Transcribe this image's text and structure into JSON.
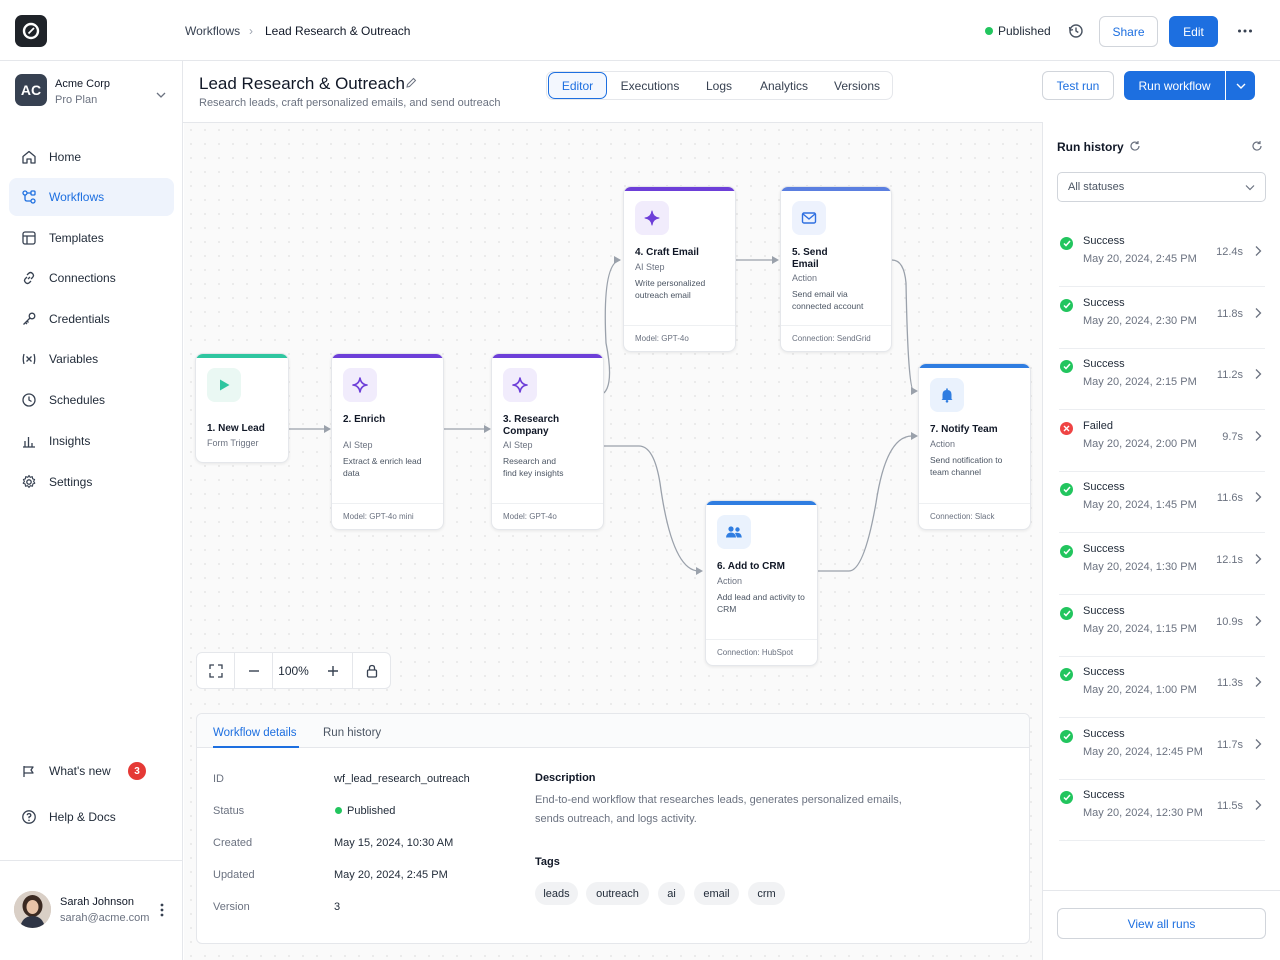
{
  "topbar": {
    "breadcrumb": [
      "Workflows",
      "Lead Research & Outreach"
    ],
    "status": "Published",
    "share_label": "Share",
    "edit_label": "Edit"
  },
  "org": {
    "initials": "AC",
    "name": "Acme Corp",
    "plan": "Pro Plan"
  },
  "sidebar": {
    "items": [
      {
        "label": "Home",
        "icon": "home-icon"
      },
      {
        "label": "Workflows",
        "icon": "workflow-icon",
        "active": true
      },
      {
        "label": "Templates",
        "icon": "template-icon"
      },
      {
        "label": "Connections",
        "icon": "link-icon"
      },
      {
        "label": "Credentials",
        "icon": "key-icon"
      },
      {
        "label": "Variables",
        "icon": "variable-icon"
      },
      {
        "label": "Schedules",
        "icon": "clock-icon"
      },
      {
        "label": "Insights",
        "icon": "chart-icon"
      },
      {
        "label": "Settings",
        "icon": "gear-icon"
      }
    ],
    "whats_new": "What's new",
    "whats_new_badge": "3",
    "help": "Help & Docs"
  },
  "user": {
    "name": "Sarah Johnson",
    "email": "sarah@acme.com"
  },
  "header": {
    "title": "Lead Research & Outreach",
    "subtitle": "Research leads, craft personalized emails, and send outreach",
    "tabs": [
      "Editor",
      "Executions",
      "Logs",
      "Analytics",
      "Versions"
    ],
    "active_tab": "Editor",
    "test_run_label": "Test run",
    "run_label": "Run workflow"
  },
  "nodes": {
    "n1": {
      "title": "1. New Lead",
      "sub": "Form Trigger"
    },
    "n2": {
      "title": "2. Enrich",
      "sub": "AI Step",
      "desc": "Extract & enrich lead data",
      "foot": "Model: GPT-4o mini"
    },
    "n3": {
      "title": "3. Research Company",
      "sub": "AI Step",
      "desc": "Research and find key insights",
      "foot": "Model: GPT-4o"
    },
    "n4": {
      "title": "4. Craft Email",
      "sub": "AI Step",
      "desc": "Write personalized outreach email",
      "foot": "Model: GPT-4o"
    },
    "n5": {
      "title": "5. Send Email",
      "sub": "Action",
      "desc": "Send email via connected account",
      "foot": "Connection: SendGrid"
    },
    "n6": {
      "title": "6. Add to CRM",
      "sub": "Action",
      "desc": "Add lead and activity to CRM",
      "foot": "Connection: HubSpot"
    },
    "n7": {
      "title": "7. Notify Team",
      "sub": "Action",
      "desc": "Send notification to team channel",
      "foot": "Connection: Slack"
    }
  },
  "zoom": {
    "level": "100%"
  },
  "details": {
    "tabs": [
      "Workflow details",
      "Run history"
    ],
    "id_label": "ID",
    "id": "wf_lead_research_outreach",
    "status_label": "Status",
    "status": "Published",
    "created_label": "Created",
    "created": "May 15, 2024, 10:30 AM",
    "updated_label": "Updated",
    "updated": "May 20, 2024, 2:45 PM",
    "version_label": "Version",
    "version": "3",
    "description_label": "Description",
    "description": "End-to-end workflow that researches leads, generates personalized emails, sends outreach, and logs activity.",
    "tags_label": "Tags",
    "tags": [
      "leads",
      "outreach",
      "ai",
      "email",
      "crm"
    ]
  },
  "run_history": {
    "title": "Run history",
    "filter": "All statuses",
    "view_all": "View all runs",
    "runs": [
      {
        "status": "Success",
        "date": "May 20, 2024, 2:45 PM",
        "duration": "12.4s"
      },
      {
        "status": "Success",
        "date": "May 20, 2024, 2:30 PM",
        "duration": "11.8s"
      },
      {
        "status": "Success",
        "date": "May 20, 2024, 2:15 PM",
        "duration": "11.2s"
      },
      {
        "status": "Failed",
        "date": "May 20, 2024, 2:00 PM",
        "duration": "9.7s"
      },
      {
        "status": "Success",
        "date": "May 20, 2024, 1:45 PM",
        "duration": "11.6s"
      },
      {
        "status": "Success",
        "date": "May 20, 2024, 1:30 PM",
        "duration": "12.1s"
      },
      {
        "status": "Success",
        "date": "May 20, 2024, 1:15 PM",
        "duration": "10.9s"
      },
      {
        "status": "Success",
        "date": "May 20, 2024, 1:00 PM",
        "duration": "11.3s"
      },
      {
        "status": "Success",
        "date": "May 20, 2024, 12:45 PM",
        "duration": "11.7s"
      },
      {
        "status": "Success",
        "date": "May 20, 2024, 12:30 PM",
        "duration": "11.5s"
      }
    ]
  },
  "colors": {
    "accent": "#1d6fe0",
    "trigger": "#2fc6a0",
    "ai": "#6d3fd8",
    "action": "#2f7de1",
    "success": "#22c55e",
    "failed": "#ef4444"
  }
}
